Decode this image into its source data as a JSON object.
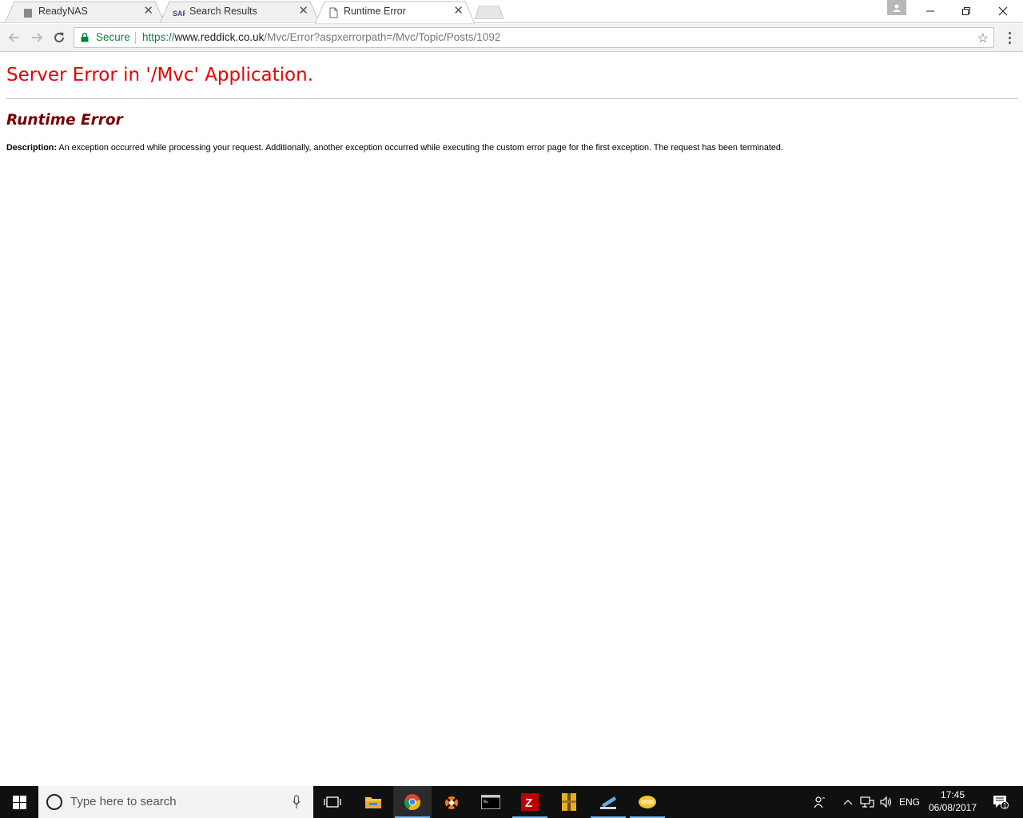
{
  "browser": {
    "tabs": [
      {
        "title": "ReadyNAS",
        "favicon": "readynas-favicon",
        "active": false
      },
      {
        "title": "Search Results",
        "favicon": "saf-favicon",
        "active": false
      },
      {
        "title": "Runtime Error",
        "favicon": "document-icon",
        "active": true
      }
    ],
    "close_glyph": "✕",
    "omnibox": {
      "secure_label": "Secure",
      "url_scheme": "https://",
      "url_host_prefix": "www.",
      "url_domain": "reddick.co.uk",
      "url_path": "/Mvc/Error?aspxerrorpath=/Mvc/Topic/Posts/1092"
    },
    "colors": {
      "secure_green": "#0b8043",
      "toolbar_bg": "#f2f2f2"
    }
  },
  "page": {
    "heading": "Server Error in '/Mvc' Application.",
    "subheading": "Runtime Error",
    "description_label": "Description:",
    "description_text": "An exception occurred while processing your request. Additionally, another exception occurred while executing the custom error page for the first exception. The request has been terminated.",
    "colors": {
      "heading": "#e80000",
      "subheading": "#7a0000"
    }
  },
  "taskbar": {
    "search_placeholder": "Type here to search",
    "apps": [
      "task-view-icon",
      "file-explorer-icon",
      "chrome-icon",
      "avast-icon",
      "command-prompt-icon",
      "filezilla-icon",
      "winrar-icon",
      "remote-desktop-icon",
      "mail-app-icon"
    ],
    "tray": {
      "language": "ENG",
      "time": "17:45",
      "date": "06/08/2017",
      "notification_count": "1"
    }
  }
}
